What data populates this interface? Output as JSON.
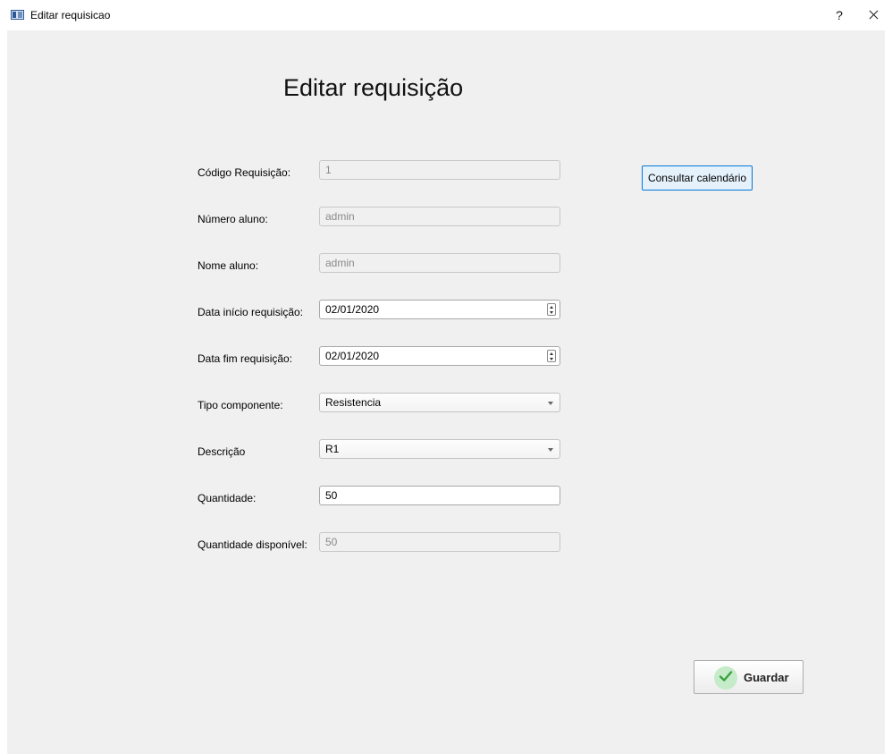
{
  "window": {
    "title": "Editar requisicao",
    "help": "?",
    "close": "close"
  },
  "page": {
    "title": "Editar requisição"
  },
  "form": {
    "codigo": {
      "label": "Código Requisição:",
      "value": "1"
    },
    "numero_aluno": {
      "label": "Número aluno:",
      "value": "admin"
    },
    "nome_aluno": {
      "label": "Nome aluno:",
      "value": "admin"
    },
    "data_inicio": {
      "label": "Data início requisição:",
      "value": "02/01/2020"
    },
    "data_fim": {
      "label": "Data fim requisição:",
      "value": "02/01/2020"
    },
    "tipo_componente": {
      "label": "Tipo componente:",
      "value": "Resistencia"
    },
    "descricao": {
      "label": "Descrição",
      "value": "R1"
    },
    "quantidade": {
      "label": "Quantidade:",
      "value": "50"
    },
    "quantidade_disponivel": {
      "label": "Quantidade disponível:",
      "value": "50"
    }
  },
  "buttons": {
    "consultar_calendario": "Consultar calendário",
    "guardar": "Guardar"
  },
  "icons": {
    "app": "window-icon",
    "save": "check-icon"
  },
  "colors": {
    "accent": "#0078d7",
    "check": "#3aa241"
  }
}
